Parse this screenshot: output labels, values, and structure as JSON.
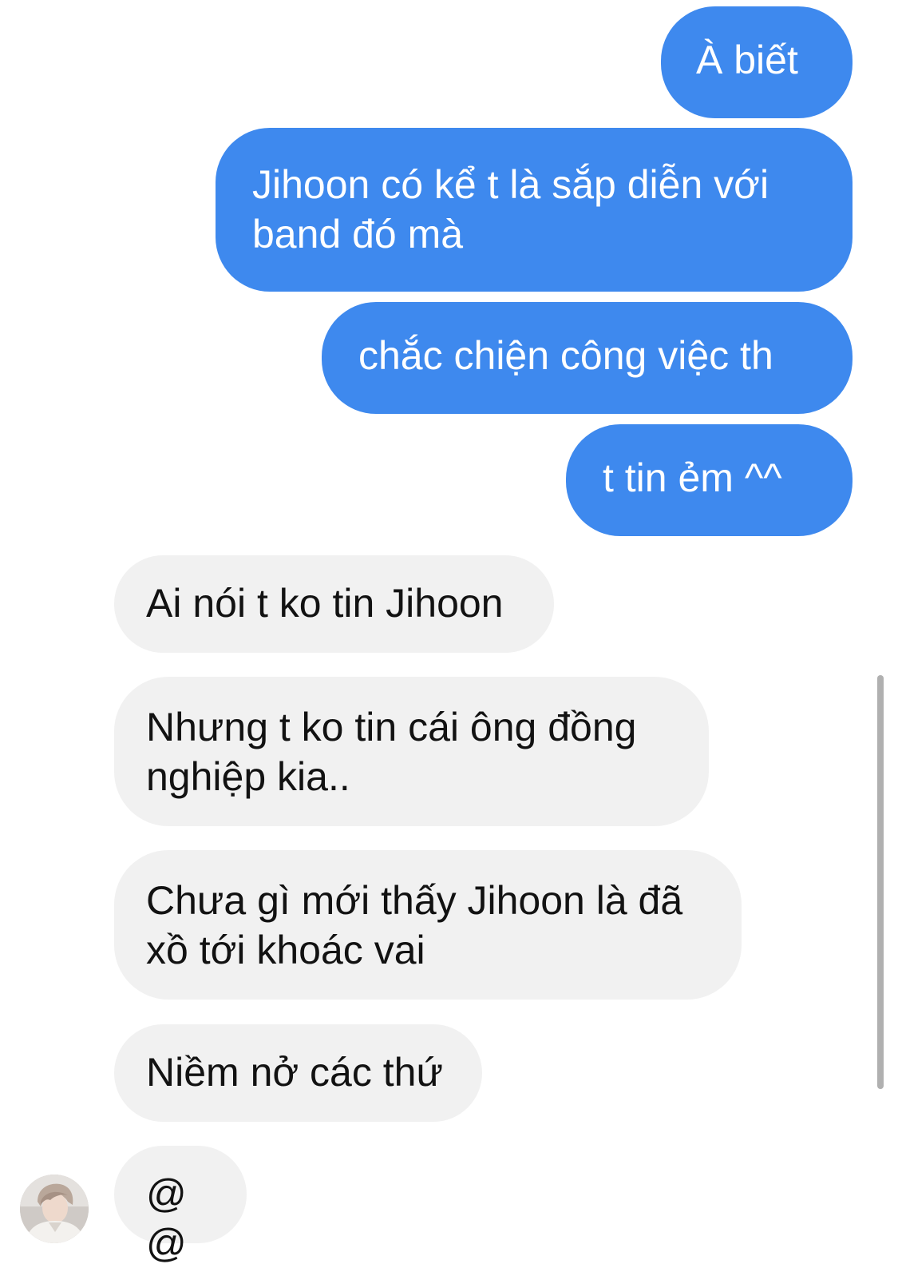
{
  "conversation": {
    "outgoing": [
      {
        "text": "À biết"
      },
      {
        "text": "Jihoon có kể t là sắp diễn với band đó mà"
      },
      {
        "text": "chắc chiện công việc th"
      },
      {
        "text": "t tin ẻm ^^"
      }
    ],
    "incoming": [
      {
        "text": "Ai nói t ko tin Jihoon"
      },
      {
        "text": "Nhưng t ko tin cái ông đồng nghiệp kia.."
      },
      {
        "text": "Chưa gì mới thấy Jihoon là đã xồ tới khoác vai"
      },
      {
        "text": "Niềm nở các thứ"
      },
      {
        "text": "@@"
      }
    ]
  },
  "colors": {
    "outgoing_bubble": "#3e89ee",
    "incoming_bubble": "#f1f1f1",
    "outgoing_text": "#ffffff",
    "incoming_text": "#121212"
  }
}
